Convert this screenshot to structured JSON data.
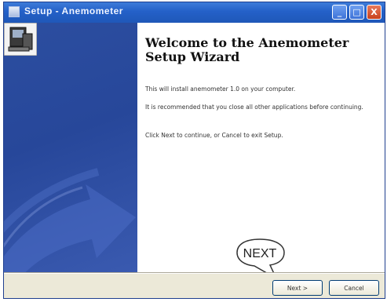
{
  "window": {
    "title": "Setup - Anemometer",
    "minimize_symbol": "_",
    "maximize_symbol": "□",
    "close_symbol": "X"
  },
  "content": {
    "heading": "Welcome to the Anemometer Setup Wizard",
    "paragraph1": "This will install anemometer 1.0 on your computer.",
    "paragraph2": "It is recommended that you close all other applications before continuing.",
    "paragraph3": "Click Next to continue, or Cancel to exit Setup."
  },
  "buttons": {
    "next_label": "Next >",
    "cancel_label": "Cancel"
  },
  "callout": {
    "text": "NEXT"
  },
  "icons": {
    "setup": "setup-computer-icon",
    "app": "app-icon"
  }
}
